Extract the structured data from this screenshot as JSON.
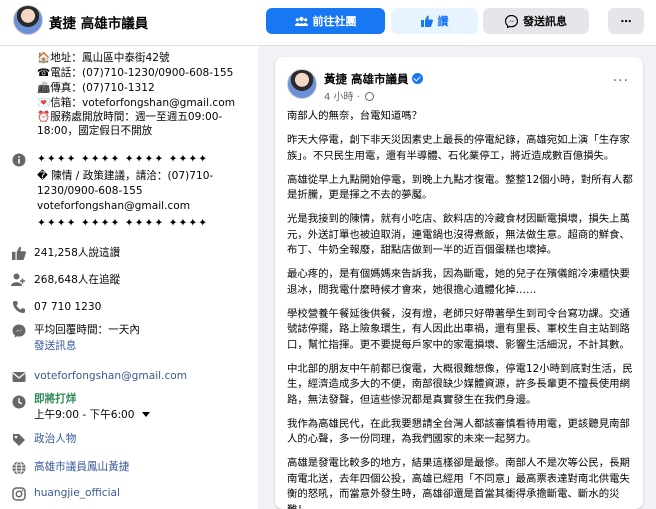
{
  "header": {
    "page_name": "黃捷 高雄市議員",
    "community_button": "前往社團",
    "like_button": "讚",
    "message_button": "發送訊息",
    "more_button": "⋯"
  },
  "intro": {
    "address": "🏠地址：鳳山區中泰街42號",
    "phone": "☎電話：(07)710-1230/0900-608-155",
    "fax": "📠傳真：(07)710-1312",
    "email_box": "💌信箱：voteforfongshan@gmail.com",
    "hours_line1": "⏰服務處開放時間：週一至週五09:00-",
    "hours_line2": "18:00，國定假日不開放",
    "divider1": "✦✦✦✦ ✦✦✦✦ ✦✦✦✦ ✦✦✦✦",
    "petition_line1": "� 陳情 / 政策建議，請洽：(07)710-",
    "petition_line2": "1230/0900-608-155",
    "petition_email": "voteforfongshan@gmail.com",
    "divider2": "✦✦✦✦ ✦✦✦✦ ✦✦✦✦ ✦✦✦✦",
    "likes": "241,258人說這讚",
    "followers": "268,648人在追蹤",
    "phone_number": "07 710 1230",
    "response_time": "平均回覆時間：一天內",
    "send_message": "發送訊息",
    "email": "voteforfongshan@gmail.com",
    "open_status": "即將打烊",
    "open_hours": "上午9:00 - 下午6:00",
    "category": "政治人物",
    "website": "高雄市議員鳳山黃捷",
    "instagram": "huangjie_official"
  },
  "post": {
    "author": "黃捷 高雄市議員",
    "time": "4 小時 ·",
    "more": "···",
    "paragraphs": [
      "南部人的無奈，台電知道嗎？",
      "昨天大停電，創下非天災因素史上最長的停電紀錄，高雄宛如上演「生存家族」。不只民生用電，還有半導體、石化業停工，將近造成數百億損失。",
      "高雄從早上九點開始停電，到晚上九點才復電。整整12個小時，對所有人都是折騰，更是揮之不去的夢魘。",
      "光是我接到的陳情，就有小吃店、飲料店的冷藏食材因斷電損壞，損失上萬元，外送訂單也被迫取消，連電鍋也沒得煮飯，無法做生意。超商的鮮食、布丁、牛奶全報廢，甜點店做到一半的近百個蛋糕也壞掉。",
      "最心疼的，是有個媽媽來告訴我，因為斷電，她的兒子在殯儀館冷凍櫃快要退冰，問我電什麼時候才會來，她很擔心遺體化掉……",
      "學校營養午餐延後供餐，沒有燈，老師只好帶著學生到司令台寫功課。交通號誌停擺，路上險象環生，有人因此出車禍，還有里長、軍校生自主站到路口，幫忙指揮。更不要提每戶家中的家電損壞、影響生活細況，不計其數。",
      "中北部的朋友中午前都已復電，大概很難想像，停電12小時到底對生活，民生，經濟造成多大的不便，南部很缺少媒體資源，許多長輩更不擅長使用網路，無法發聲，但這些慘況都是真實發生在我們身邊。",
      "我作為高雄民代，在此我要懇請全台灣人都該審慎看待用電，更該聽見南部人的心聲，多一份同理，為我們國家的未來一起努力。",
      "高雄是發電比較多的地方，結果這樣卻是最慘。南部人不是次等公民，長期南電北送，去年四個公投，高雄已經用「不同意」最高票表達對南北供電失衡的怒吼，而當意外發生時，高雄卻還是首當其衝得承擔斷電、斷水的災難！"
    ]
  },
  "colors": {
    "brand_blue": "#1877f2",
    "link": "#385898",
    "open_green": "#2e8b57",
    "background": "#f0f2f5"
  }
}
